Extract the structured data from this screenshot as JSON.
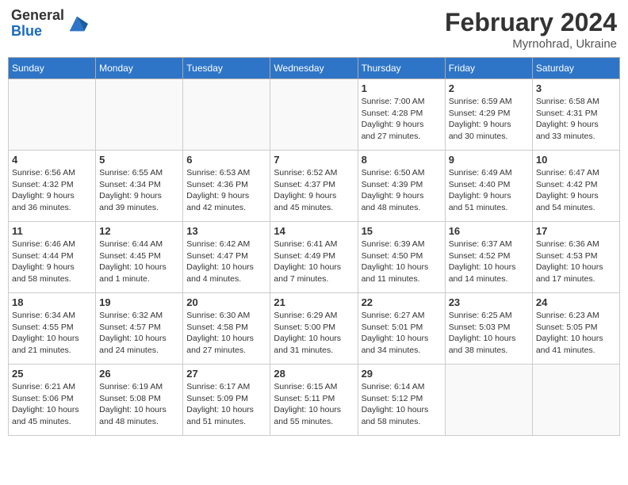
{
  "header": {
    "logo_general": "General",
    "logo_blue": "Blue",
    "month_year": "February 2024",
    "location": "Myrnohrad, Ukraine"
  },
  "days_of_week": [
    "Sunday",
    "Monday",
    "Tuesday",
    "Wednesday",
    "Thursday",
    "Friday",
    "Saturday"
  ],
  "weeks": [
    [
      {
        "day": "",
        "info": ""
      },
      {
        "day": "",
        "info": ""
      },
      {
        "day": "",
        "info": ""
      },
      {
        "day": "",
        "info": ""
      },
      {
        "day": "1",
        "info": "Sunrise: 7:00 AM\nSunset: 4:28 PM\nDaylight: 9 hours\nand 27 minutes."
      },
      {
        "day": "2",
        "info": "Sunrise: 6:59 AM\nSunset: 4:29 PM\nDaylight: 9 hours\nand 30 minutes."
      },
      {
        "day": "3",
        "info": "Sunrise: 6:58 AM\nSunset: 4:31 PM\nDaylight: 9 hours\nand 33 minutes."
      }
    ],
    [
      {
        "day": "4",
        "info": "Sunrise: 6:56 AM\nSunset: 4:32 PM\nDaylight: 9 hours\nand 36 minutes."
      },
      {
        "day": "5",
        "info": "Sunrise: 6:55 AM\nSunset: 4:34 PM\nDaylight: 9 hours\nand 39 minutes."
      },
      {
        "day": "6",
        "info": "Sunrise: 6:53 AM\nSunset: 4:36 PM\nDaylight: 9 hours\nand 42 minutes."
      },
      {
        "day": "7",
        "info": "Sunrise: 6:52 AM\nSunset: 4:37 PM\nDaylight: 9 hours\nand 45 minutes."
      },
      {
        "day": "8",
        "info": "Sunrise: 6:50 AM\nSunset: 4:39 PM\nDaylight: 9 hours\nand 48 minutes."
      },
      {
        "day": "9",
        "info": "Sunrise: 6:49 AM\nSunset: 4:40 PM\nDaylight: 9 hours\nand 51 minutes."
      },
      {
        "day": "10",
        "info": "Sunrise: 6:47 AM\nSunset: 4:42 PM\nDaylight: 9 hours\nand 54 minutes."
      }
    ],
    [
      {
        "day": "11",
        "info": "Sunrise: 6:46 AM\nSunset: 4:44 PM\nDaylight: 9 hours\nand 58 minutes."
      },
      {
        "day": "12",
        "info": "Sunrise: 6:44 AM\nSunset: 4:45 PM\nDaylight: 10 hours\nand 1 minute."
      },
      {
        "day": "13",
        "info": "Sunrise: 6:42 AM\nSunset: 4:47 PM\nDaylight: 10 hours\nand 4 minutes."
      },
      {
        "day": "14",
        "info": "Sunrise: 6:41 AM\nSunset: 4:49 PM\nDaylight: 10 hours\nand 7 minutes."
      },
      {
        "day": "15",
        "info": "Sunrise: 6:39 AM\nSunset: 4:50 PM\nDaylight: 10 hours\nand 11 minutes."
      },
      {
        "day": "16",
        "info": "Sunrise: 6:37 AM\nSunset: 4:52 PM\nDaylight: 10 hours\nand 14 minutes."
      },
      {
        "day": "17",
        "info": "Sunrise: 6:36 AM\nSunset: 4:53 PM\nDaylight: 10 hours\nand 17 minutes."
      }
    ],
    [
      {
        "day": "18",
        "info": "Sunrise: 6:34 AM\nSunset: 4:55 PM\nDaylight: 10 hours\nand 21 minutes."
      },
      {
        "day": "19",
        "info": "Sunrise: 6:32 AM\nSunset: 4:57 PM\nDaylight: 10 hours\nand 24 minutes."
      },
      {
        "day": "20",
        "info": "Sunrise: 6:30 AM\nSunset: 4:58 PM\nDaylight: 10 hours\nand 27 minutes."
      },
      {
        "day": "21",
        "info": "Sunrise: 6:29 AM\nSunset: 5:00 PM\nDaylight: 10 hours\nand 31 minutes."
      },
      {
        "day": "22",
        "info": "Sunrise: 6:27 AM\nSunset: 5:01 PM\nDaylight: 10 hours\nand 34 minutes."
      },
      {
        "day": "23",
        "info": "Sunrise: 6:25 AM\nSunset: 5:03 PM\nDaylight: 10 hours\nand 38 minutes."
      },
      {
        "day": "24",
        "info": "Sunrise: 6:23 AM\nSunset: 5:05 PM\nDaylight: 10 hours\nand 41 minutes."
      }
    ],
    [
      {
        "day": "25",
        "info": "Sunrise: 6:21 AM\nSunset: 5:06 PM\nDaylight: 10 hours\nand 45 minutes."
      },
      {
        "day": "26",
        "info": "Sunrise: 6:19 AM\nSunset: 5:08 PM\nDaylight: 10 hours\nand 48 minutes."
      },
      {
        "day": "27",
        "info": "Sunrise: 6:17 AM\nSunset: 5:09 PM\nDaylight: 10 hours\nand 51 minutes."
      },
      {
        "day": "28",
        "info": "Sunrise: 6:15 AM\nSunset: 5:11 PM\nDaylight: 10 hours\nand 55 minutes."
      },
      {
        "day": "29",
        "info": "Sunrise: 6:14 AM\nSunset: 5:12 PM\nDaylight: 10 hours\nand 58 minutes."
      },
      {
        "day": "",
        "info": ""
      },
      {
        "day": "",
        "info": ""
      }
    ]
  ]
}
